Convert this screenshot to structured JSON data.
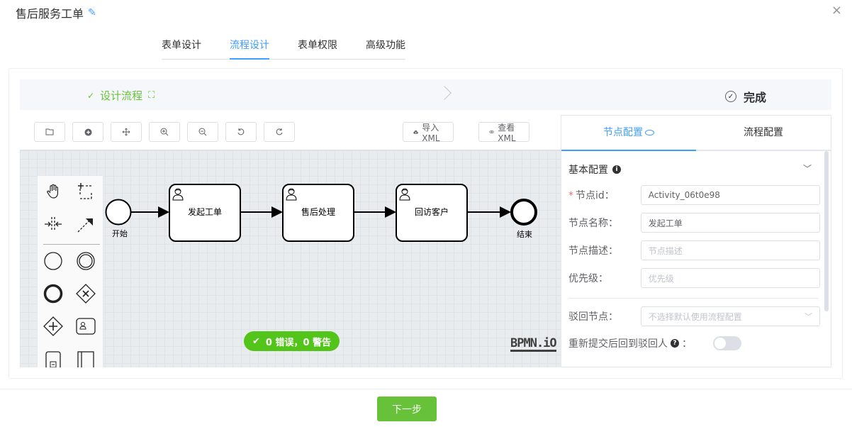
{
  "dialog": {
    "title": "售后服务工单",
    "close_label": "×"
  },
  "tabs": [
    {
      "label": "表单设计",
      "active": false
    },
    {
      "label": "流程设计",
      "active": true
    },
    {
      "label": "表单权限",
      "active": false
    },
    {
      "label": "高级功能",
      "active": false
    }
  ],
  "steps": {
    "step1_label": "设计流程",
    "step2_label": "完成"
  },
  "toolbar": {
    "import_label": "导入XML",
    "view_label": "查看XML"
  },
  "diagram": {
    "start_label": "开始",
    "end_label": "结束",
    "tasks": [
      "发起工单",
      "售后处理",
      "回访客户"
    ]
  },
  "status": {
    "text": "0 错误，0 警告",
    "color": "#52c41a"
  },
  "watermark": "BPMN.iO",
  "panel": {
    "tab_node": "节点配置",
    "tab_flow": "流程配置",
    "section_title": "基本配置",
    "fields": {
      "node_id": {
        "label": "节点id：",
        "value": "Activity_06t0e98"
      },
      "node_name": {
        "label": "节点名称：",
        "value": "发起工单"
      },
      "node_desc": {
        "label": "节点描述：",
        "placeholder": "节点描述"
      },
      "priority": {
        "label": "优先级：",
        "placeholder": "优先级"
      },
      "reject_node": {
        "label": "驳回节点：",
        "placeholder": "不选择默认使用流程配置"
      }
    },
    "resubmit_label": "重新提交后回到驳回人",
    "resubmit_colon": "：",
    "resubmit_enabled": false
  },
  "footer": {
    "next_label": "下一步"
  },
  "colors": {
    "accent": "#409eff",
    "success": "#67c23a"
  }
}
